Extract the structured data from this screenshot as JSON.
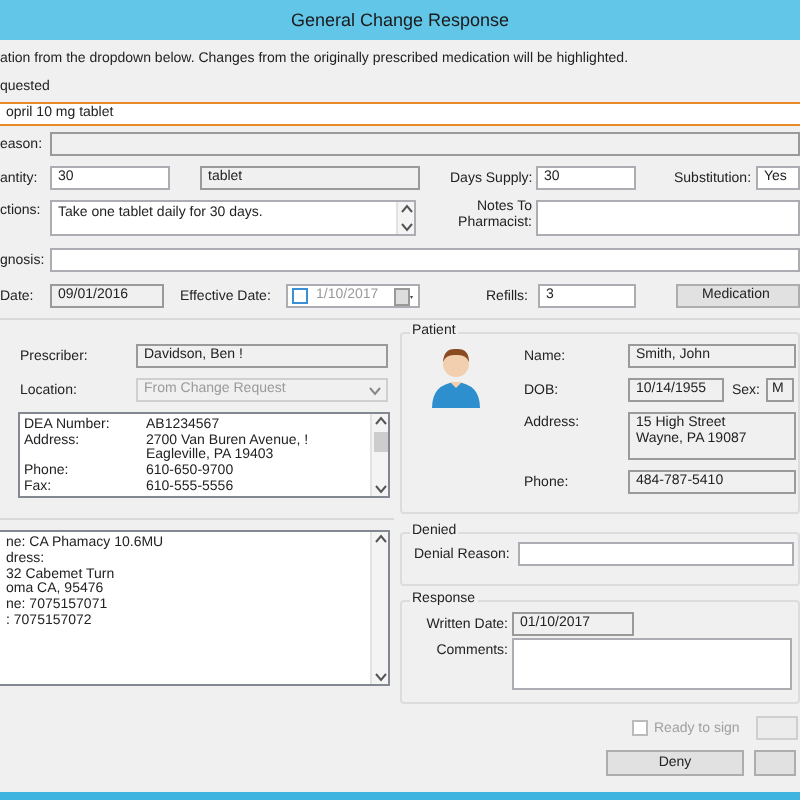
{
  "window": {
    "title": "General Change Response"
  },
  "instruction": "ation from the dropdown below. Changes from the originally prescribed medication will be highlighted.",
  "medication": {
    "label": "quested",
    "value": "opril 10 mg tablet",
    "highlighted": true
  },
  "reason": {
    "label": "eason:"
  },
  "quantity": {
    "label": "antity:",
    "value": "30",
    "unit": "tablet"
  },
  "days_supply": {
    "label": "Days Supply:",
    "value": "30"
  },
  "substitution": {
    "label": "Substitution:",
    "value": "Yes"
  },
  "directions": {
    "label": "ctions:",
    "value": "Take one tablet daily for 30 days."
  },
  "notes": {
    "label": "Notes To Pharmacist:"
  },
  "diagnosis": {
    "label": "gnosis:"
  },
  "date": {
    "label": "Date:",
    "value": "09/01/2016"
  },
  "effective_date": {
    "label": "Effective Date:",
    "value": "1/10/2017",
    "checked": false
  },
  "refills": {
    "label": "Refills:",
    "value": "3"
  },
  "medication_button": "Medication",
  "prescriber": {
    "label": "Prescriber:",
    "value": "Davidson, Ben !",
    "location_label": "Location:",
    "location": "From Change Request",
    "details": [
      {
        "label": "DEA Number:",
        "value": "AB1234567"
      },
      {
        "label": "Address:",
        "value": "2700 Van Buren Avenue, !"
      },
      {
        "value": "Eagleville, PA 19403"
      },
      {
        "label": "Phone:",
        "value": "610-650-9700"
      },
      {
        "label": "Fax:",
        "value": "610-555-5556"
      }
    ]
  },
  "pharmacy_lines": [
    "ne: CA Phamacy 10.6MU",
    "dress:",
    "32 Cabemet Turn",
    "oma CA, 95476",
    "ne: 7075157071",
    ": 7075157072"
  ],
  "patient": {
    "title": "Patient",
    "name_label": "Name:",
    "name": "Smith, John",
    "dob_label": "DOB:",
    "dob": "10/14/1955",
    "sex_label": "Sex:",
    "sex": "M",
    "address_label": "Address:",
    "address": [
      "15 High Street",
      "Wayne, PA 19087"
    ],
    "phone_label": "Phone:",
    "phone": "484-787-5410"
  },
  "denied": {
    "title": "Denied",
    "label": "Denial Reason:"
  },
  "response": {
    "title": "Response",
    "written_date_label": "Written Date:",
    "written_date": "01/10/2017",
    "comments_label": "Comments:"
  },
  "ready_to_sign": {
    "label": "Ready to sign",
    "checked": false,
    "disabled": true
  },
  "deny_button": "Deny"
}
